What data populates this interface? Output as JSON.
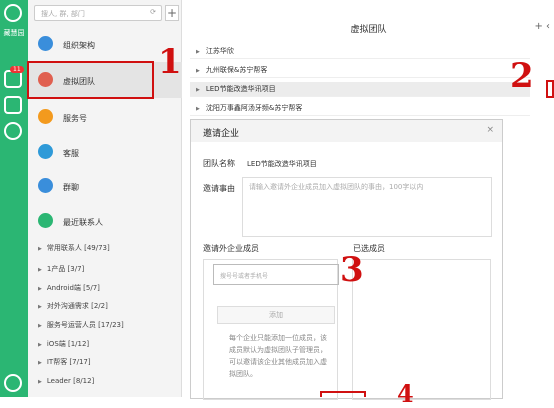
{
  "rail": {
    "brand": "藏慧园",
    "badge": "11"
  },
  "search": {
    "placeholder": "搜人, 群, 部门"
  },
  "nav": [
    {
      "label": "组织架构",
      "color": "#3a8edb"
    },
    {
      "label": "虚拟团队",
      "color": "#e06050"
    },
    {
      "label": "服务号",
      "color": "#f39a1e"
    },
    {
      "label": "客服",
      "color": "#2e9ad8"
    },
    {
      "label": "群聊",
      "color": "#3a8edb"
    },
    {
      "label": "最近联系人",
      "color": "#2bb673"
    }
  ],
  "groups": [
    "常用联系人 [49/73]",
    "1产品 [3/7]",
    "Android端 [5/7]",
    "对外沟通需求 [2/2]",
    "服务号运营人员 [17/23]",
    "iOS端 [1/12]",
    "IT帮客 [7/17]",
    "Leader [8/12]"
  ],
  "main": {
    "title": "虚拟团队",
    "teams": [
      "江苏华欣",
      "九州联保&苏宁帮客",
      "LED节能改造华讯项目",
      "沈阳万事鑫阿汤牙频&苏宁帮客"
    ]
  },
  "dialog": {
    "title": "邀请企业",
    "close": "×",
    "team_name_label": "团队名称",
    "team_name_value": "LED节能改造华讯项目",
    "reason_label": "邀请事由",
    "reason_placeholder": "请输入邀请外企业成员加入虚拟团队的事由，100字以内",
    "invite_label": "邀请外企业成员",
    "selected_label": "已选成员",
    "member_placeholder": "搜号号或者手机号",
    "add_button": "添加",
    "hint": "每个企业只能添加一位成员，该成员默认为虚拟团队子管理员，可以邀请该企业其他成员加入虚拟团队。"
  },
  "annotations": [
    "1",
    "2",
    "3",
    "4"
  ]
}
